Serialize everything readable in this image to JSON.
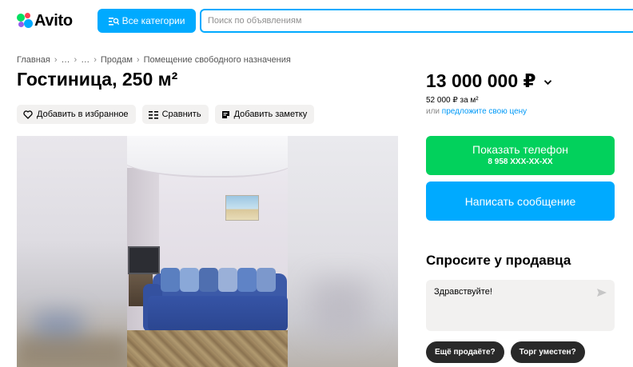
{
  "header": {
    "logo_text": "Avito",
    "logo_colors": [
      "#04e061",
      "#ff4053",
      "#965eeb",
      "#0af"
    ],
    "categories_label": "Все категории",
    "search_placeholder": "Поиск по объявлениям"
  },
  "breadcrumb": [
    "Главная",
    "…",
    "…",
    "Продам",
    "Помещение свободного назначения"
  ],
  "listing": {
    "title": "Гостиница, 250 м²",
    "actions": {
      "favorite": "Добавить в избранное",
      "compare": "Сравнить",
      "note": "Добавить заметку"
    }
  },
  "price": {
    "value": "13 000 000 ₽",
    "per_meter": "52 000 ₽ за м²",
    "offer_prefix": "или",
    "offer_link": "предложите свою цену"
  },
  "contact": {
    "show_phone_label": "Показать телефон",
    "phone_masked": "8 958 XXX-XX-XX",
    "message_label": "Написать сообщение"
  },
  "ask_seller": {
    "title": "Спросите у продавца",
    "message_value": "Здравствуйте!",
    "quick_questions": [
      "Ещё продаёте?",
      "Торг уместен?"
    ]
  },
  "colors": {
    "accent_blue": "#00aaff",
    "phone_green": "#02d15c",
    "chip_dark": "#292929",
    "link_blue": "#0099f7"
  }
}
